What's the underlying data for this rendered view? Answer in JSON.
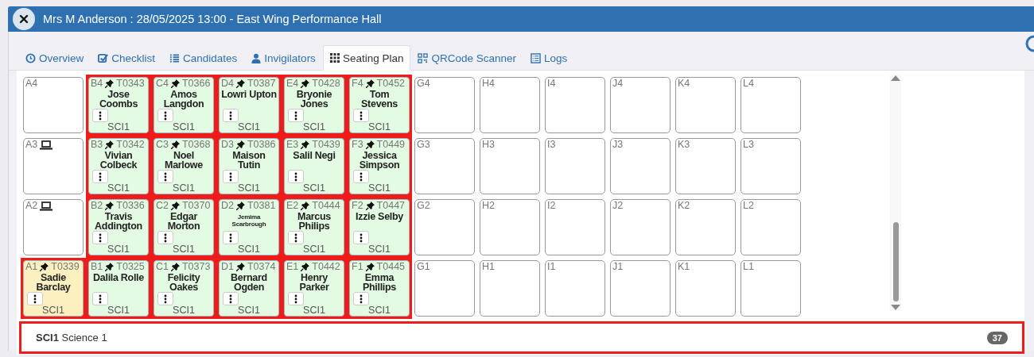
{
  "window": {
    "title": "Mrs M Anderson : 28/05/2025 13:00 - East Wing Performance Hall"
  },
  "tabs": [
    {
      "label": "Overview",
      "selected": false
    },
    {
      "label": "Checklist",
      "selected": false
    },
    {
      "label": "Candidates",
      "selected": false
    },
    {
      "label": "Invigilators",
      "selected": false
    },
    {
      "label": "Seating Plan",
      "selected": true
    },
    {
      "label": "QRCode Scanner",
      "selected": false
    },
    {
      "label": "Logs",
      "selected": false
    }
  ],
  "seating_rows": [
    [
      {
        "kind": "empty",
        "label": "A4",
        "laptop": false,
        "highlighted": false
      },
      {
        "kind": "assigned",
        "label": "B4",
        "pinned": true,
        "candidate": "T0343",
        "name": "Jose Coombs",
        "subject": "SCI1",
        "color": "#e2fbe2",
        "compact": false,
        "highlighted": true
      },
      {
        "kind": "assigned",
        "label": "C4",
        "pinned": true,
        "candidate": "T0366",
        "name": "Amos Langdon",
        "subject": "SCI1",
        "color": "#e2fbe2",
        "compact": false,
        "highlighted": true
      },
      {
        "kind": "assigned",
        "label": "D4",
        "pinned": true,
        "candidate": "T0387",
        "name": "Lowri Upton",
        "subject": "SCI1",
        "color": "#e2fbe2",
        "compact": false,
        "highlighted": true
      },
      {
        "kind": "assigned",
        "label": "E4",
        "pinned": true,
        "candidate": "T0428",
        "name": "Bryonie Jones",
        "subject": "SCI1",
        "color": "#e2fbe2",
        "compact": false,
        "highlighted": true
      },
      {
        "kind": "assigned",
        "label": "F4",
        "pinned": true,
        "candidate": "T0452",
        "name": "Tom Stevens",
        "subject": "SCI1",
        "color": "#e2fbe2",
        "compact": false,
        "highlighted": true
      },
      {
        "kind": "empty",
        "label": "G4",
        "laptop": false,
        "highlighted": false
      },
      {
        "kind": "empty",
        "label": "H4",
        "laptop": false,
        "highlighted": false
      },
      {
        "kind": "empty",
        "label": "I4",
        "laptop": false,
        "highlighted": false
      },
      {
        "kind": "empty",
        "label": "J4",
        "laptop": false,
        "highlighted": false
      },
      {
        "kind": "empty",
        "label": "K4",
        "laptop": false,
        "highlighted": false
      },
      {
        "kind": "empty",
        "label": "L4",
        "laptop": false,
        "highlighted": false
      }
    ],
    [
      {
        "kind": "empty",
        "label": "A3",
        "laptop": true,
        "highlighted": false
      },
      {
        "kind": "assigned",
        "label": "B3",
        "pinned": true,
        "candidate": "T0342",
        "name": "Vivian Colbeck",
        "subject": "SCI1",
        "color": "#e2fbe2",
        "compact": false,
        "highlighted": true
      },
      {
        "kind": "assigned",
        "label": "C3",
        "pinned": true,
        "candidate": "T0368",
        "name": "Noel Marlowe",
        "subject": "SCI1",
        "color": "#e2fbe2",
        "compact": false,
        "highlighted": true
      },
      {
        "kind": "assigned",
        "label": "D3",
        "pinned": true,
        "candidate": "T0386",
        "name": "Maison Tutin",
        "subject": "SCI1",
        "color": "#e2fbe2",
        "compact": false,
        "highlighted": true
      },
      {
        "kind": "assigned",
        "label": "E3",
        "pinned": true,
        "candidate": "T0439",
        "name": "Salil Negi",
        "subject": "SCI1",
        "color": "#e2fbe2",
        "compact": false,
        "highlighted": true
      },
      {
        "kind": "assigned",
        "label": "F3",
        "pinned": true,
        "candidate": "T0449",
        "name": "Jessica Simpson",
        "subject": "SCI1",
        "color": "#e2fbe2",
        "compact": false,
        "highlighted": true
      },
      {
        "kind": "empty",
        "label": "G3",
        "laptop": false,
        "highlighted": false
      },
      {
        "kind": "empty",
        "label": "H3",
        "laptop": false,
        "highlighted": false
      },
      {
        "kind": "empty",
        "label": "I3",
        "laptop": false,
        "highlighted": false
      },
      {
        "kind": "empty",
        "label": "J3",
        "laptop": false,
        "highlighted": false
      },
      {
        "kind": "empty",
        "label": "K3",
        "laptop": false,
        "highlighted": false
      },
      {
        "kind": "empty",
        "label": "L3",
        "laptop": false,
        "highlighted": false
      }
    ],
    [
      {
        "kind": "empty",
        "label": "A2",
        "laptop": true,
        "highlighted": false
      },
      {
        "kind": "assigned",
        "label": "B2",
        "pinned": true,
        "candidate": "T0336",
        "name": "Travis Addington",
        "subject": "SCI1",
        "color": "#e2fbe2",
        "compact": false,
        "highlighted": true
      },
      {
        "kind": "assigned",
        "label": "C2",
        "pinned": true,
        "candidate": "T0370",
        "name": "Edgar Morton",
        "subject": "SCI1",
        "color": "#e2fbe2",
        "compact": false,
        "highlighted": true
      },
      {
        "kind": "assigned",
        "label": "D2",
        "pinned": true,
        "candidate": "T0381",
        "name": "Jemima Scarbrough",
        "subject": "SCI1",
        "color": "#e2fbe2",
        "compact": true,
        "highlighted": true
      },
      {
        "kind": "assigned",
        "label": "E2",
        "pinned": true,
        "candidate": "T0444",
        "name": "Marcus Philips",
        "subject": "SCI1",
        "color": "#e2fbe2",
        "compact": false,
        "highlighted": true
      },
      {
        "kind": "assigned",
        "label": "F2",
        "pinned": true,
        "candidate": "T0447",
        "name": "Izzie Selby",
        "subject": "SCI1",
        "color": "#e2fbe2",
        "compact": false,
        "highlighted": true
      },
      {
        "kind": "empty",
        "label": "G2",
        "laptop": false,
        "highlighted": false
      },
      {
        "kind": "empty",
        "label": "H2",
        "laptop": false,
        "highlighted": false
      },
      {
        "kind": "empty",
        "label": "I2",
        "laptop": false,
        "highlighted": false
      },
      {
        "kind": "empty",
        "label": "J2",
        "laptop": false,
        "highlighted": false
      },
      {
        "kind": "empty",
        "label": "K2",
        "laptop": false,
        "highlighted": false
      },
      {
        "kind": "empty",
        "label": "L2",
        "laptop": false,
        "highlighted": false
      }
    ],
    [
      {
        "kind": "assigned",
        "label": "A1",
        "pinned": true,
        "candidate": "T0339",
        "name": "Sadie Barclay",
        "subject": "SCI1",
        "color": "#fdf0c0",
        "compact": false,
        "highlighted": true
      },
      {
        "kind": "assigned",
        "label": "B1",
        "pinned": true,
        "candidate": "T0325",
        "name": "Dalila Rolle",
        "subject": "SCI1",
        "color": "#e2fbe2",
        "compact": false,
        "highlighted": true
      },
      {
        "kind": "assigned",
        "label": "C1",
        "pinned": true,
        "candidate": "T0373",
        "name": "Felicity Oakes",
        "subject": "SCI1",
        "color": "#e2fbe2",
        "compact": false,
        "highlighted": true
      },
      {
        "kind": "assigned",
        "label": "D1",
        "pinned": true,
        "candidate": "T0374",
        "name": "Bernard Ogden",
        "subject": "SCI1",
        "color": "#e2fbe2",
        "compact": false,
        "highlighted": true
      },
      {
        "kind": "assigned",
        "label": "E1",
        "pinned": true,
        "candidate": "T0442",
        "name": "Henry Parker",
        "subject": "SCI1",
        "color": "#e2fbe2",
        "compact": false,
        "highlighted": true
      },
      {
        "kind": "assigned",
        "label": "F1",
        "pinned": true,
        "candidate": "T0445",
        "name": "Emma Phillips",
        "subject": "SCI1",
        "color": "#e2fbe2",
        "compact": false,
        "highlighted": true
      },
      {
        "kind": "empty",
        "label": "G1",
        "laptop": false,
        "highlighted": false
      },
      {
        "kind": "empty",
        "label": "H1",
        "laptop": false,
        "highlighted": false
      },
      {
        "kind": "empty",
        "label": "I1",
        "laptop": false,
        "highlighted": false
      },
      {
        "kind": "empty",
        "label": "J1",
        "laptop": false,
        "highlighted": false
      },
      {
        "kind": "empty",
        "label": "K1",
        "laptop": false,
        "highlighted": false
      },
      {
        "kind": "empty",
        "label": "L1",
        "laptop": false,
        "highlighted": false
      }
    ]
  ],
  "subject_group": {
    "code": "SCI1",
    "name": "Science 1",
    "count": "37",
    "highlighted": true
  }
}
